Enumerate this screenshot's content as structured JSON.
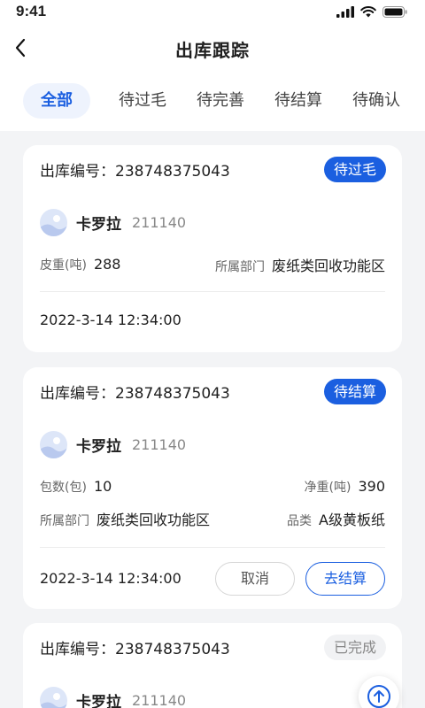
{
  "status_bar": {
    "time": "9:41"
  },
  "nav": {
    "title": "出库跟踪"
  },
  "tabs": [
    {
      "label": "全部",
      "active": true
    },
    {
      "label": "待过毛",
      "active": false
    },
    {
      "label": "待完善",
      "active": false
    },
    {
      "label": "待结算",
      "active": false
    },
    {
      "label": "待确认",
      "active": false
    }
  ],
  "cards": [
    {
      "order_no": "出库编号：238748375043",
      "status": "待过毛",
      "user_name": "卡罗拉",
      "user_id": "211140",
      "tare_label": "皮重(吨)",
      "tare_value": "288",
      "dept_label": "所属部门",
      "dept_value": "废纸类回收功能区",
      "time": "2022-3-14   12:34:00"
    },
    {
      "order_no": "出库编号：238748375043",
      "status": "待结算",
      "user_name": "卡罗拉",
      "user_id": "211140",
      "pack_label": "包数(包)",
      "pack_value": "10",
      "net_label": "净重(吨)",
      "net_value": "390",
      "dept_label": "所属部门",
      "dept_value": "废纸类回收功能区",
      "cat_label": "品类",
      "cat_value": "A级黄板纸",
      "time": "2022-3-14   12:34:00",
      "cancel_label": "取消",
      "settle_label": "去结算"
    },
    {
      "order_no": "出库编号：238748375043",
      "status": "已完成",
      "user_name": "卡罗拉",
      "user_id": "211140"
    }
  ],
  "colors": {
    "accent": "#1b5fe0",
    "background": "#f3f4f6",
    "card": "#ffffff"
  },
  "icons": {
    "back": "chevron-left-icon",
    "fab": "arrow-up-icon",
    "avatar": "avatar-placeholder-icon"
  }
}
